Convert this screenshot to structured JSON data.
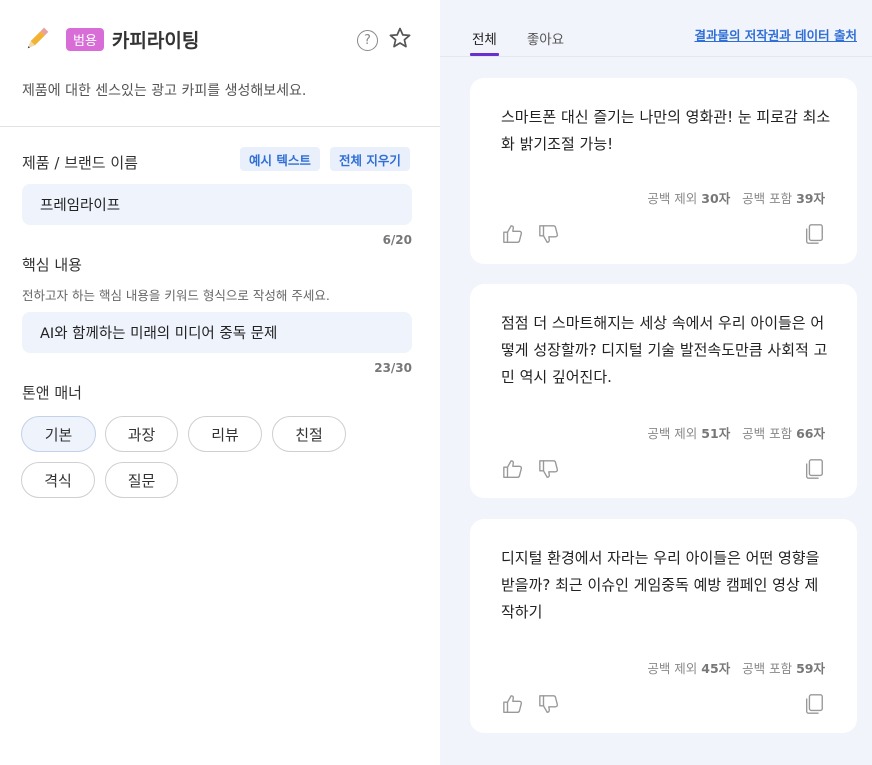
{
  "header": {
    "badge": "범용",
    "title": "카피라이팅",
    "help_glyph": "?",
    "description": "제품에 대한 센스있는 광고 카피를 생성해보세요."
  },
  "form": {
    "product": {
      "label": "제품 / 브랜드 이름",
      "example_button": "예시 텍스트",
      "clear_button": "전체 지우기",
      "value": "프레임라이프",
      "count": "6/20"
    },
    "core": {
      "label": "핵심 내용",
      "helper": "전하고자 하는 핵심 내용을 키워드 형식으로 작성해 주세요.",
      "value": "AI와 함께하는 미래의 미디어 중독 문제",
      "count": "23/30"
    },
    "tone": {
      "label": "톤앤 매너",
      "options": [
        "기본",
        "과장",
        "리뷰",
        "친절",
        "격식",
        "질문"
      ],
      "selected": "기본"
    }
  },
  "results": {
    "tabs": [
      "전체",
      "좋아요"
    ],
    "active_tab": "전체",
    "source_link": "결과물의 저작권과 데이터 출처",
    "meta_labels": {
      "without_space": "공백 제외",
      "with_space": "공백 포함"
    },
    "cards": [
      {
        "text": "스마트폰 대신 즐기는 나만의 영화관! 눈 피로감 최소화 밝기조절 가능!",
        "without_space": "30자",
        "with_space": "39자"
      },
      {
        "text": "점점 더 스마트해지는 세상 속에서 우리 아이들은 어떻게 성장할까? 디지털 기술 발전속도만큼 사회적 고민 역시 깊어진다.",
        "without_space": "51자",
        "with_space": "66자"
      },
      {
        "text": "디지털 환경에서 자라는 우리 아이들은 어떤 영향을 받을까? 최근 이슈인 게임중독 예방 캠페인 영상 제작하기",
        "without_space": "45자",
        "with_space": "59자"
      }
    ]
  },
  "colors": {
    "badge": "#d96dd8",
    "accent_blue": "#2f6fd6",
    "tab_indicator": "#6a2fd0",
    "right_bg": "#f2f4fb",
    "field_bg": "#eef3fc"
  },
  "icons": [
    "pencil-icon",
    "help-icon",
    "star-icon",
    "thumbs-up-icon",
    "thumbs-down-icon",
    "copy-icon"
  ]
}
